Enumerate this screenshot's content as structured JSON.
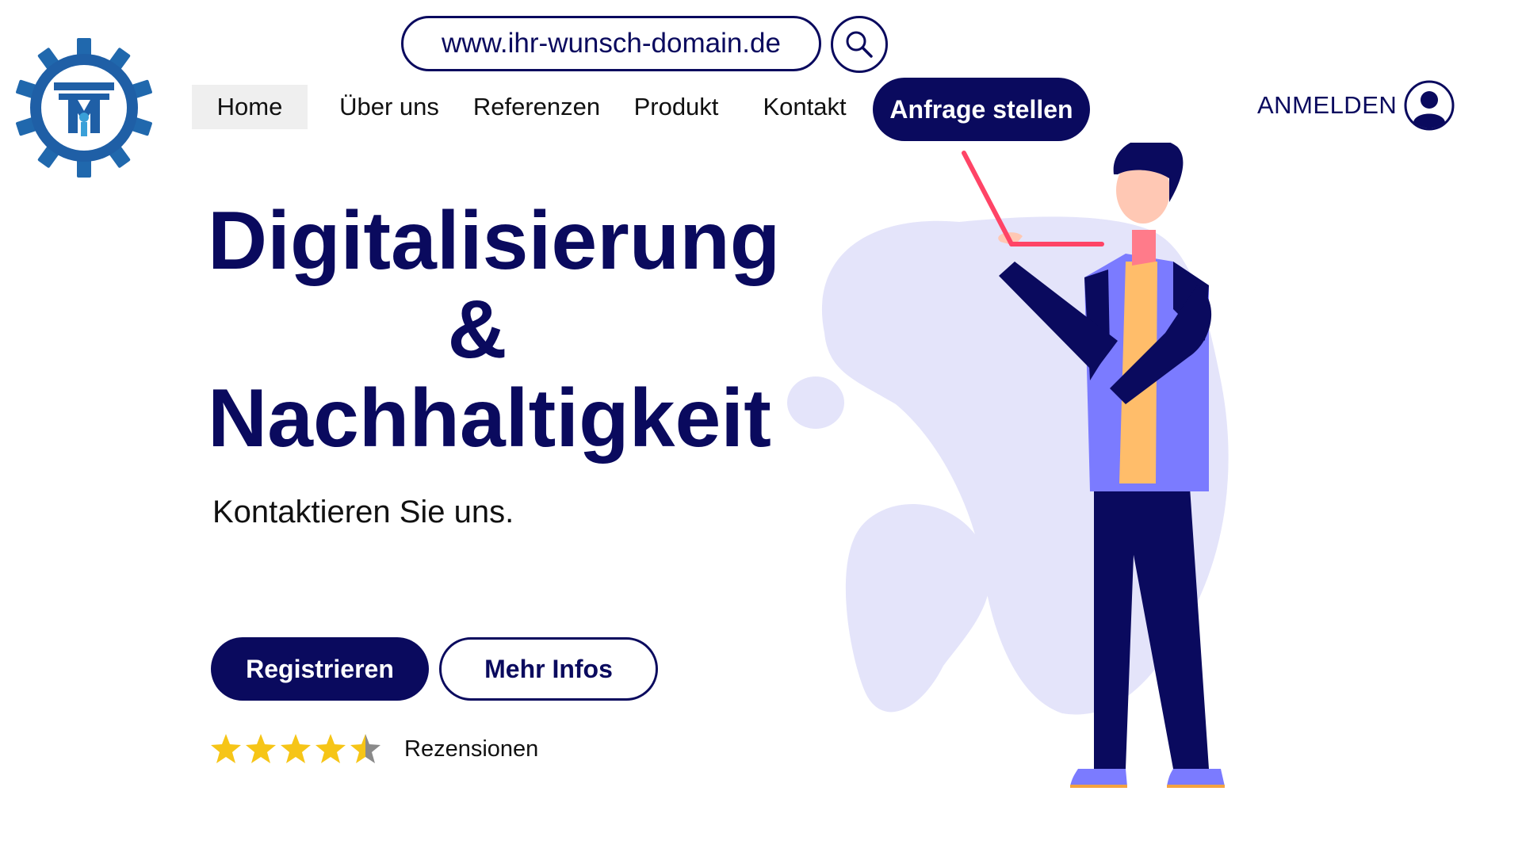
{
  "header": {
    "url": "www.ihr-wunsch-domain.de",
    "search_icon": "magnifier-icon",
    "cta_label": "Anfrage stellen",
    "login_label": "ANMELDEN",
    "login_icon": "user-circle-icon"
  },
  "nav": {
    "items": [
      {
        "label": "Home",
        "active": true
      },
      {
        "label": "Über uns"
      },
      {
        "label": "Referenzen"
      },
      {
        "label": "Produkt"
      },
      {
        "label": "Kontakt"
      }
    ]
  },
  "hero": {
    "title_line1": "Digitalisierung",
    "title_line2": "&",
    "title_line3": "Nachhaltigkeit",
    "subtitle": "Kontaktieren Sie uns.",
    "primary_button": "Registrieren",
    "secondary_button": "Mehr Infos",
    "rating": 4.5,
    "rating_max": 5,
    "reviews_label": "Rezensionen"
  },
  "colors": {
    "primary": "#0a0a5e",
    "blob": "#e4e4fa",
    "star": "#f6c517",
    "logo_blue": "#1f5fa6"
  }
}
